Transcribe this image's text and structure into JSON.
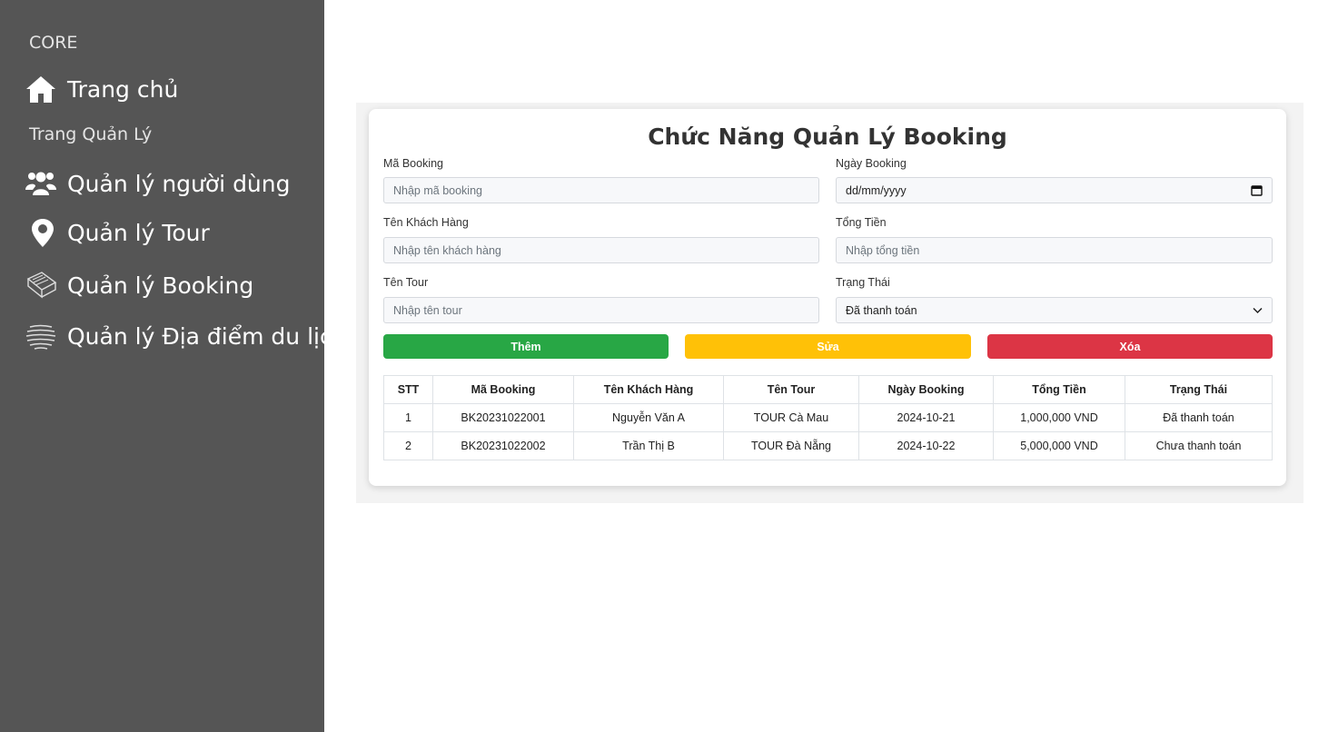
{
  "sidebar": {
    "core_heading": "CORE",
    "home_label": "Trang chủ",
    "manage_heading": "Trang Quản Lý",
    "items": [
      {
        "label": "Quản lý người dùng",
        "icon": "users-icon"
      },
      {
        "label": "Quản lý Tour",
        "icon": "map-pin-icon"
      },
      {
        "label": "Quản lý Booking",
        "icon": "book-icon"
      },
      {
        "label": "Quản lý Địa điểm du lịch",
        "icon": "globe-icon"
      }
    ]
  },
  "form": {
    "title": "Chức Năng Quản Lý Booking",
    "booking_id": {
      "label": "Mã Booking",
      "placeholder": "Nhập mã booking"
    },
    "booking_date": {
      "label": "Ngày Booking",
      "placeholder": "dd/mm/yyyy"
    },
    "customer_name": {
      "label": "Tên Khách Hàng",
      "placeholder": "Nhập tên khách hàng"
    },
    "total": {
      "label": "Tổng Tiền",
      "placeholder": "Nhập tổng tiền"
    },
    "tour_name": {
      "label": "Tên Tour",
      "placeholder": "Nhập tên tour"
    },
    "status": {
      "label": "Trạng Thái",
      "value": "Đã thanh toán"
    }
  },
  "buttons": {
    "add": "Thêm",
    "edit": "Sửa",
    "delete": "Xóa"
  },
  "colors": {
    "add": "#28a745",
    "edit": "#ffc107",
    "delete": "#dc3545"
  },
  "table": {
    "headers": [
      "STT",
      "Mã Booking",
      "Tên Khách Hàng",
      "Tên Tour",
      "Ngày Booking",
      "Tổng Tiền",
      "Trạng Thái"
    ],
    "rows": [
      [
        "1",
        "BK20231022001",
        "Nguyễn Văn A",
        "TOUR Cà Mau",
        "2024-10-21",
        "1,000,000 VND",
        "Đã thanh toán"
      ],
      [
        "2",
        "BK20231022002",
        "Trần Thị B",
        "TOUR Đà Nẵng",
        "2024-10-22",
        "5,000,000 VND",
        "Chưa thanh toán"
      ]
    ]
  }
}
